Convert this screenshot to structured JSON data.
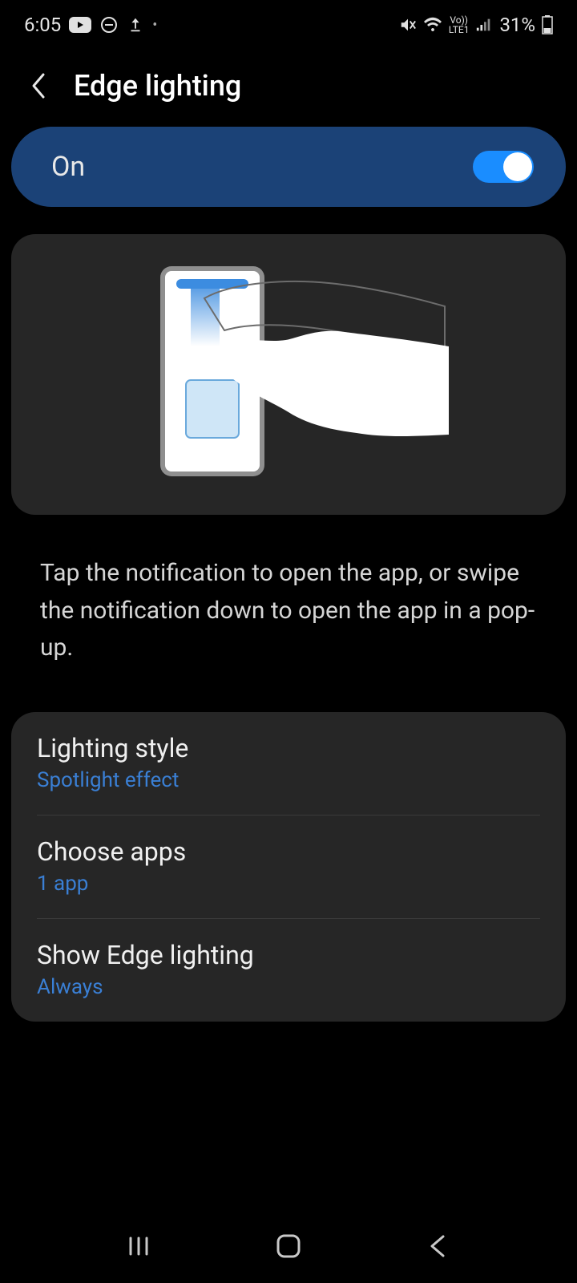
{
  "status": {
    "time": "6:05",
    "battery": "31%",
    "network_label": "LTE1",
    "volte": "Vo))"
  },
  "header": {
    "title": "Edge lighting"
  },
  "toggle": {
    "label": "On",
    "state": true
  },
  "description": "Tap the notification to open the app, or swipe the notification down to open the app in a pop-up.",
  "settings": {
    "lighting_style": {
      "title": "Lighting style",
      "value": "Spotlight effect"
    },
    "choose_apps": {
      "title": "Choose apps",
      "value": "1 app"
    },
    "show_edge": {
      "title": "Show Edge lighting",
      "value": "Always"
    }
  }
}
